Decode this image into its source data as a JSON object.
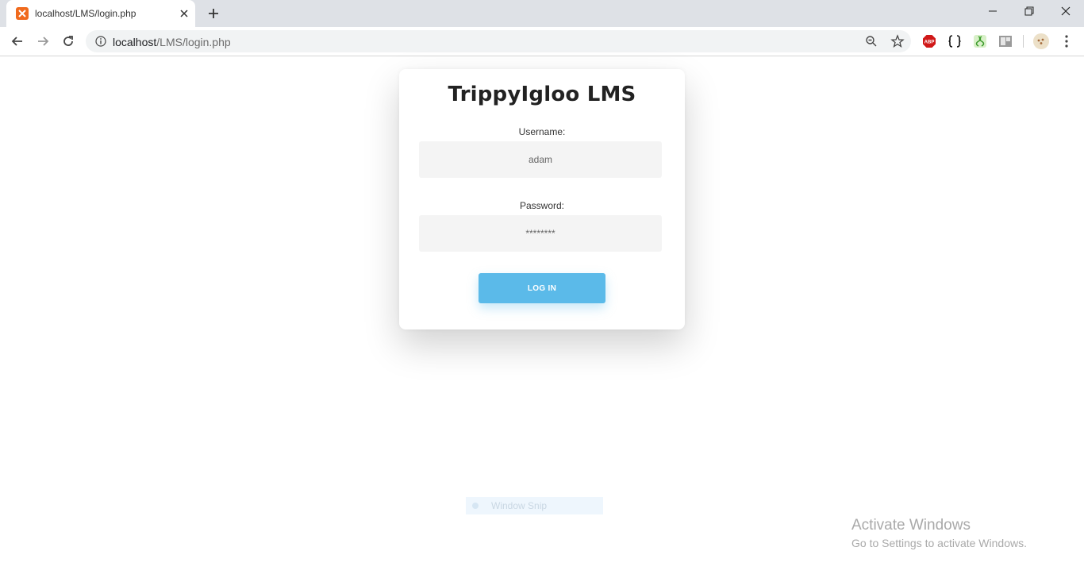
{
  "browser": {
    "tab_title": "localhost/LMS/login.php",
    "url_host": "localhost",
    "url_path": "/LMS/login.php"
  },
  "login": {
    "title": "TrippyIgloo LMS",
    "username_label": "Username:",
    "username_value": "adam",
    "password_label": "Password:",
    "password_value": "********",
    "button_label": "LOG IN"
  },
  "overlay": {
    "snip_label": "Window Snip",
    "activate_title": "Activate Windows",
    "activate_subtitle": "Go to Settings to activate Windows."
  },
  "colors": {
    "accent": "#5bbae9",
    "tab_favicon": "#f06a1d"
  }
}
